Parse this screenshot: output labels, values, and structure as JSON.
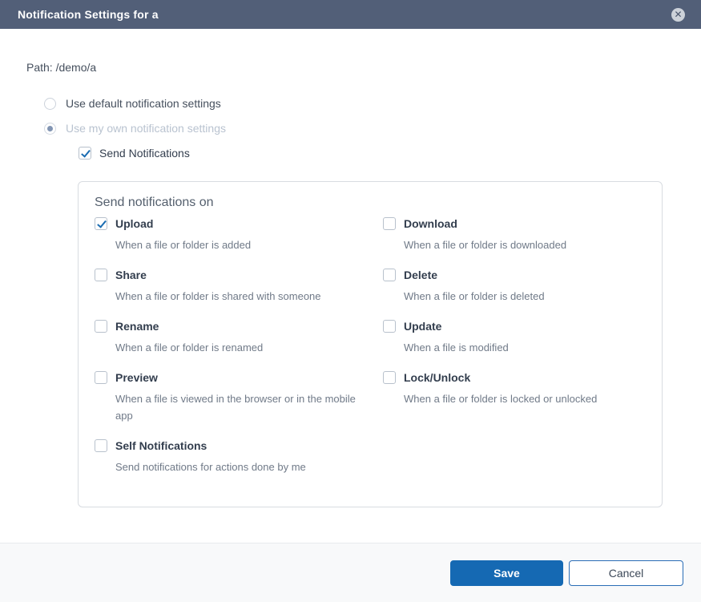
{
  "header": {
    "title": "Notification Settings for a",
    "close_glyph": "✕"
  },
  "path": {
    "text": "Path: /demo/a"
  },
  "radios": [
    {
      "label": "Use default notification settings",
      "selected": false,
      "disabled": false
    },
    {
      "label": "Use my own notification settings",
      "selected": true,
      "disabled": true
    }
  ],
  "master_checkbox": {
    "label": "Send Notifications",
    "checked": true
  },
  "panel": {
    "title": "Send notifications on",
    "items": [
      {
        "label": "Upload",
        "description": "When a file or folder is added",
        "checked": true
      },
      {
        "label": "Download",
        "description": "When a file or folder is downloaded",
        "checked": false
      },
      {
        "label": "Share",
        "description": "When a file or folder is shared with someone",
        "checked": false
      },
      {
        "label": "Delete",
        "description": "When a file or folder is deleted",
        "checked": false
      },
      {
        "label": "Rename",
        "description": "When a file or folder is renamed",
        "checked": false
      },
      {
        "label": "Update",
        "description": "When a file is modified",
        "checked": false
      },
      {
        "label": "Preview",
        "description": "When a file is viewed in the browser or in the mobile app",
        "checked": false
      },
      {
        "label": "Lock/Unlock",
        "description": "When a file or folder is locked or unlocked",
        "checked": false
      },
      {
        "label": "Self Notifications",
        "description": "Send notifications for actions done by me",
        "checked": false
      }
    ]
  },
  "footer": {
    "save_label": "Save",
    "cancel_label": "Cancel"
  },
  "colors": {
    "header_bg": "#525f78",
    "accent_blue": "#1569b3",
    "check_blue": "#1a6cb2"
  }
}
